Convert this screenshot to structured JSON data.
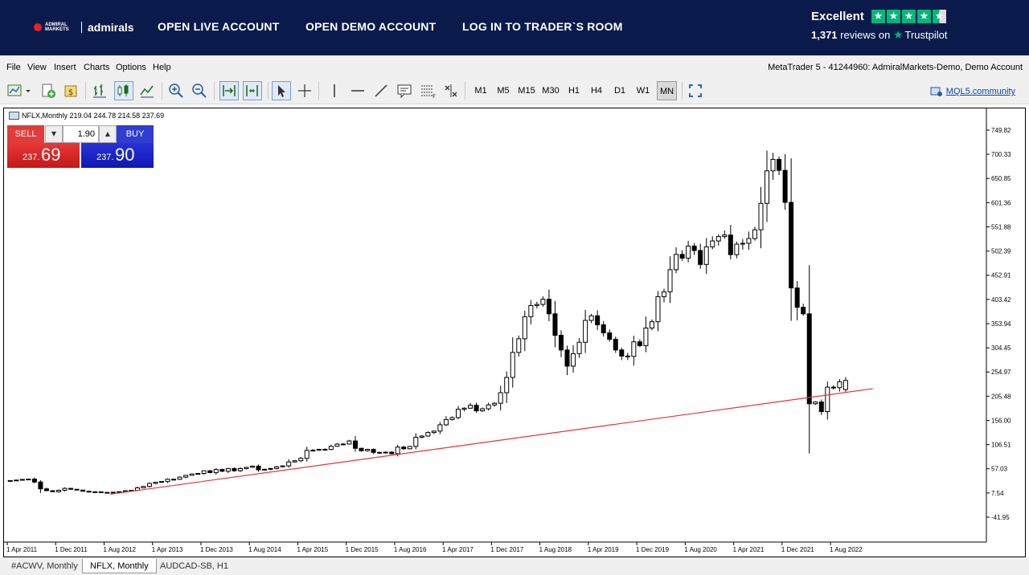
{
  "banner": {
    "logo_small": "ADMIRAL MARKETS",
    "logo_text": "admirals",
    "nav": [
      "OPEN LIVE ACCOUNT",
      "OPEN DEMO ACCOUNT",
      "LOG IN TO TRADER`S ROOM"
    ],
    "trustpilot": {
      "rating": "Excellent",
      "review_count": "1,371",
      "reviews_on": "reviews on",
      "brand": "Trustpilot",
      "stars": 4.5,
      "color": "#00b67a"
    }
  },
  "menu": {
    "items": [
      "File",
      "View",
      "Insert",
      "Charts",
      "Options",
      "Help"
    ],
    "account": "MetaTrader 5 - 41244960: AdmiralMarkets-Demo, Demo Account"
  },
  "toolbar": {
    "timeframes": [
      "M1",
      "M5",
      "M15",
      "M30",
      "H1",
      "H4",
      "D1",
      "W1",
      "MN"
    ],
    "active_timeframe": "MN",
    "community_link": "MQL5.community"
  },
  "chart": {
    "symbol_info": "NFLX,Monthly  219.04 244.78 214.58 237.69",
    "trade": {
      "sell_label": "SELL",
      "buy_label": "BUY",
      "lot": "1.90",
      "sell_small": "237.",
      "sell_big": "69",
      "buy_small": "237.",
      "buy_big": "90"
    }
  },
  "chart_data": {
    "type": "candlestick",
    "y_ticks": [
      "749.82",
      "700.33",
      "650.85",
      "601.36",
      "551.88",
      "502.39",
      "452.91",
      "403.42",
      "353.94",
      "304.45",
      "254.97",
      "205.48",
      "156.00",
      "106.51",
      "57.03",
      "7.54",
      "-41.95"
    ],
    "ylim": [
      -41.95,
      749.82
    ],
    "x_ticks": [
      "1 Apr 2011",
      "1 Dec 2011",
      "1 Aug 2012",
      "1 Apr 2013",
      "1 Dec 2013",
      "1 Aug 2014",
      "1 Apr 2015",
      "1 Dec 2015",
      "1 Aug 2016",
      "1 Apr 2017",
      "1 Dec 2017",
      "1 Aug 2018",
      "1 Apr 2019",
      "1 Dec 2019",
      "1 Aug 2020",
      "1 Apr 2021",
      "1 Dec 2021",
      "1 Aug 2022"
    ],
    "first_bar": "1 Apr 2011",
    "close_anchors": [
      [
        "2011-04",
        33
      ],
      [
        "2011-07",
        36
      ],
      [
        "2011-08",
        30
      ],
      [
        "2011-09",
        16
      ],
      [
        "2011-11",
        10
      ],
      [
        "2012-01",
        17
      ],
      [
        "2012-05",
        10
      ],
      [
        "2012-08",
        8
      ],
      [
        "2012-12",
        13
      ],
      [
        "2013-03",
        27
      ],
      [
        "2013-08",
        40
      ],
      [
        "2013-12",
        53
      ],
      [
        "2014-03",
        52
      ],
      [
        "2014-07",
        60
      ],
      [
        "2014-10",
        56
      ],
      [
        "2015-01",
        63
      ],
      [
        "2015-06",
        95
      ],
      [
        "2015-09",
        103
      ],
      [
        "2015-12",
        114
      ],
      [
        "2016-02",
        94
      ],
      [
        "2016-06",
        91
      ],
      [
        "2016-09",
        98
      ],
      [
        "2016-12",
        124
      ],
      [
        "2017-03",
        147
      ],
      [
        "2017-07",
        181
      ],
      [
        "2017-12",
        191
      ],
      [
        "2018-03",
        295
      ],
      [
        "2018-06",
        391
      ],
      [
        "2018-09",
        374
      ],
      [
        "2018-12",
        267
      ],
      [
        "2019-04",
        370
      ],
      [
        "2019-07",
        322
      ],
      [
        "2019-10",
        287
      ],
      [
        "2020-01",
        345
      ],
      [
        "2020-04",
        419
      ],
      [
        "2020-07",
        488
      ],
      [
        "2020-10",
        475
      ],
      [
        "2021-01",
        532
      ],
      [
        "2021-06",
        528
      ],
      [
        "2021-10",
        690
      ],
      [
        "2021-12",
        602
      ],
      [
        "2022-01",
        427
      ],
      [
        "2022-03",
        374
      ],
      [
        "2022-04",
        190
      ],
      [
        "2022-06",
        174
      ],
      [
        "2022-07",
        224
      ],
      [
        "2022-08",
        223
      ],
      [
        "2022-09",
        235
      ],
      [
        "2022-10",
        237.69
      ]
    ],
    "last_bar": {
      "open": 219.04,
      "high": 244.78,
      "low": 214.58,
      "close": 237.69
    },
    "trendline": {
      "start": [
        "2012-09",
        5
      ],
      "end": [
        "2023-03",
        221
      ],
      "color": "#e8303a"
    },
    "up_color": "#ffffff",
    "down_color": "#000000",
    "grid": false
  },
  "tabs": [
    "#ACWV, Monthly",
    "NFLX, Monthly",
    "AUDCAD-SB, H1"
  ],
  "active_tab": "NFLX, Monthly"
}
